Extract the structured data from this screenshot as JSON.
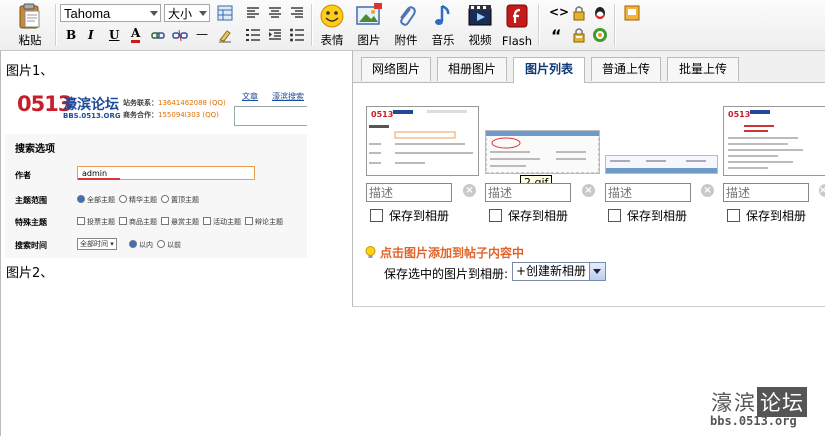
{
  "toolbar": {
    "paste": "粘贴",
    "font": "Tahoma",
    "size": "大小",
    "emoji": "表情",
    "image": "图片",
    "attach": "附件",
    "music": "音乐",
    "video": "视频",
    "flash": "Flash",
    "quote_glyph": "“",
    "code_glyph": "<>",
    "bold": "B",
    "italic": "I",
    "underline": "U",
    "color": "A",
    "hr": "—"
  },
  "editor": {
    "label1": "图片1、",
    "label2": "图片2、",
    "screenshot": {
      "logo": "0513",
      "forum_name": "濠滨论坛",
      "forum_url": "BBS.0513.ORG",
      "contact_label": "站务联系：",
      "contact_value": "13641462088 (QQ)",
      "biz_label": "商务合作：",
      "biz_value": "155094I303 (QQ)",
      "link_article": "文章",
      "link_more": "濠滨搜索",
      "section_title": "搜索选项",
      "author_label": "作者",
      "author_value": "admin",
      "scope_label": "主题范围",
      "scope_options": [
        "全部主题",
        "精华主题",
        "置顶主题"
      ],
      "special_label": "特殊主题",
      "special_options": [
        "投票主题",
        "商品主题",
        "悬赏主题",
        "活动主题",
        "辩论主题"
      ],
      "time_label": "搜索时间",
      "time_select": "全部时间",
      "time_options": [
        "以内",
        "以前"
      ]
    }
  },
  "panel": {
    "tabs": [
      "网络图片",
      "相册图片",
      "图片列表",
      "普通上传",
      "批量上传"
    ],
    "active_tab": "图片列表",
    "desc_placeholder": "描述",
    "save_label": "保存到相册",
    "tooltip": "2.gif",
    "hint": "点击图片添加到帖子内容中",
    "album_label": "保存选中的图片到相册:",
    "album_select": "+创建新相册",
    "accent": "#e0642a",
    "tab_active_color": "#0e3a76"
  },
  "watermark": {
    "brand": "濠滨",
    "brand_box": "论坛",
    "url": "bbs.0513.org"
  }
}
